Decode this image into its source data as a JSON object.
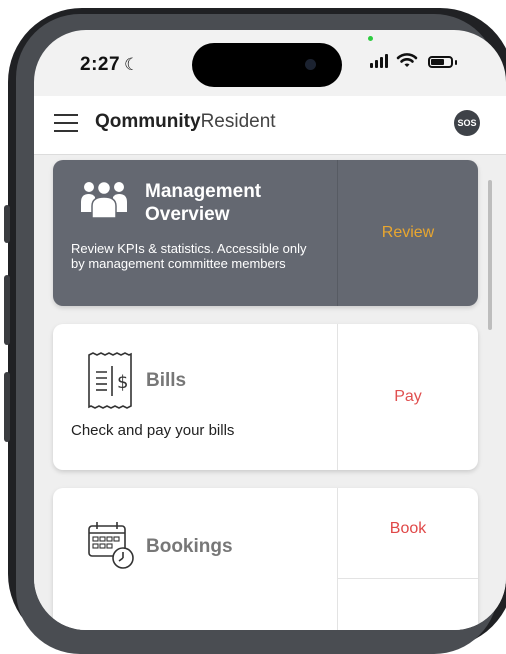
{
  "status_bar": {
    "time": "2:27"
  },
  "app": {
    "brand_bold": "Qommunity",
    "brand_regular": "Resident",
    "sos_label": "SOS"
  },
  "cards": [
    {
      "title_line1": "Management",
      "title_line2": "Overview",
      "description": "Review KPIs & statistics. Accessible only by management committee members",
      "action": "Review",
      "action_color": "#e8a630"
    },
    {
      "title": "Bills",
      "description": "Check and pay your bills",
      "action": "Pay",
      "action_color": "#e05050"
    },
    {
      "title": "Bookings",
      "action": "Book",
      "action_color": "#e04848"
    }
  ],
  "icons": [
    "menu-icon",
    "group-people-icon",
    "receipt-dollar-icon",
    "calendar-clock-icon",
    "signal-icon",
    "wifi-icon",
    "battery-icon",
    "moon-icon"
  ]
}
